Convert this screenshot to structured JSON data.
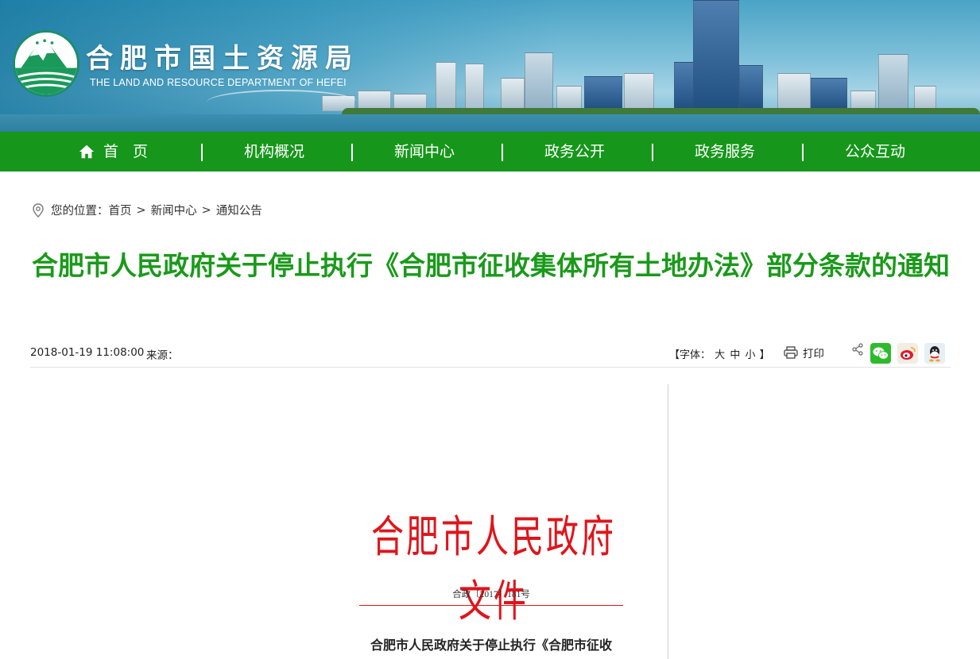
{
  "header": {
    "site_title": "合肥市国土资源局",
    "site_subtitle": "THE LAND AND RESOURCE DEPARTMENT OF HEFEI"
  },
  "nav": {
    "items": [
      {
        "label": "首页",
        "icon": "home-icon"
      },
      {
        "label": "机构概况"
      },
      {
        "label": "新闻中心"
      },
      {
        "label": "政务公开"
      },
      {
        "label": "政务服务"
      },
      {
        "label": "公众互动"
      }
    ]
  },
  "breadcrumb": {
    "prefix": "您的位置：",
    "items": [
      "首页",
      "新闻中心",
      "通知公告"
    ],
    "separator": ">"
  },
  "article": {
    "title": "合肥市人民政府关于停止执行《合肥市征收集体所有土地办法》部分条款的通知",
    "date": "2018-01-19 11:08:00",
    "source_label": "来源：",
    "font_size_label": "【字体：",
    "font_size_options": [
      "大",
      "中",
      "小"
    ],
    "font_size_close": "】",
    "print_label": "打印",
    "share_icons": [
      "share-icon",
      "wechat-icon",
      "weibo-icon",
      "qq-icon"
    ]
  },
  "document": {
    "header": "合肥市人民政府文件",
    "number": "合政〔2017〕181号",
    "title_line": "合肥市人民政府关于停止执行《合肥市征收"
  },
  "colors": {
    "nav_green": "#16961b",
    "title_green": "#1a9a1a",
    "doc_red": "#e0151b"
  }
}
